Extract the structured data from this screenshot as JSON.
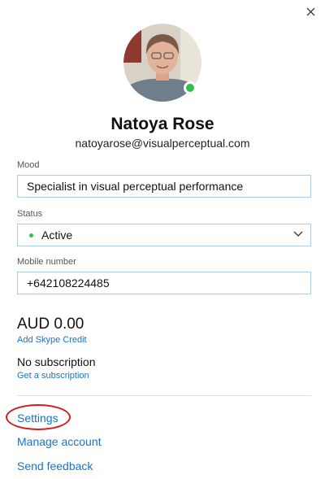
{
  "profile": {
    "name": "Natoya Rose",
    "email": "natoyarose@visualperceptual.com",
    "presence_color": "#2fbf4a"
  },
  "fields": {
    "mood_label": "Mood",
    "mood_value": "Specialist in visual perceptual performance",
    "status_label": "Status",
    "status_value": "Active",
    "mobile_label": "Mobile number",
    "mobile_value": "+642108224485"
  },
  "credit": {
    "balance": "AUD 0.00",
    "add_credit_link": "Add Skype Credit"
  },
  "subscription": {
    "text": "No subscription",
    "link": "Get a subscription"
  },
  "menu": {
    "settings": "Settings",
    "manage_account": "Manage account",
    "send_feedback": "Send feedback"
  },
  "colors": {
    "link": "#1a73c9",
    "field_border": "#a9cbe6",
    "annotation": "#d61d1d"
  },
  "icons": {
    "close": "close-icon",
    "dropdown": "chevron-down-icon"
  }
}
